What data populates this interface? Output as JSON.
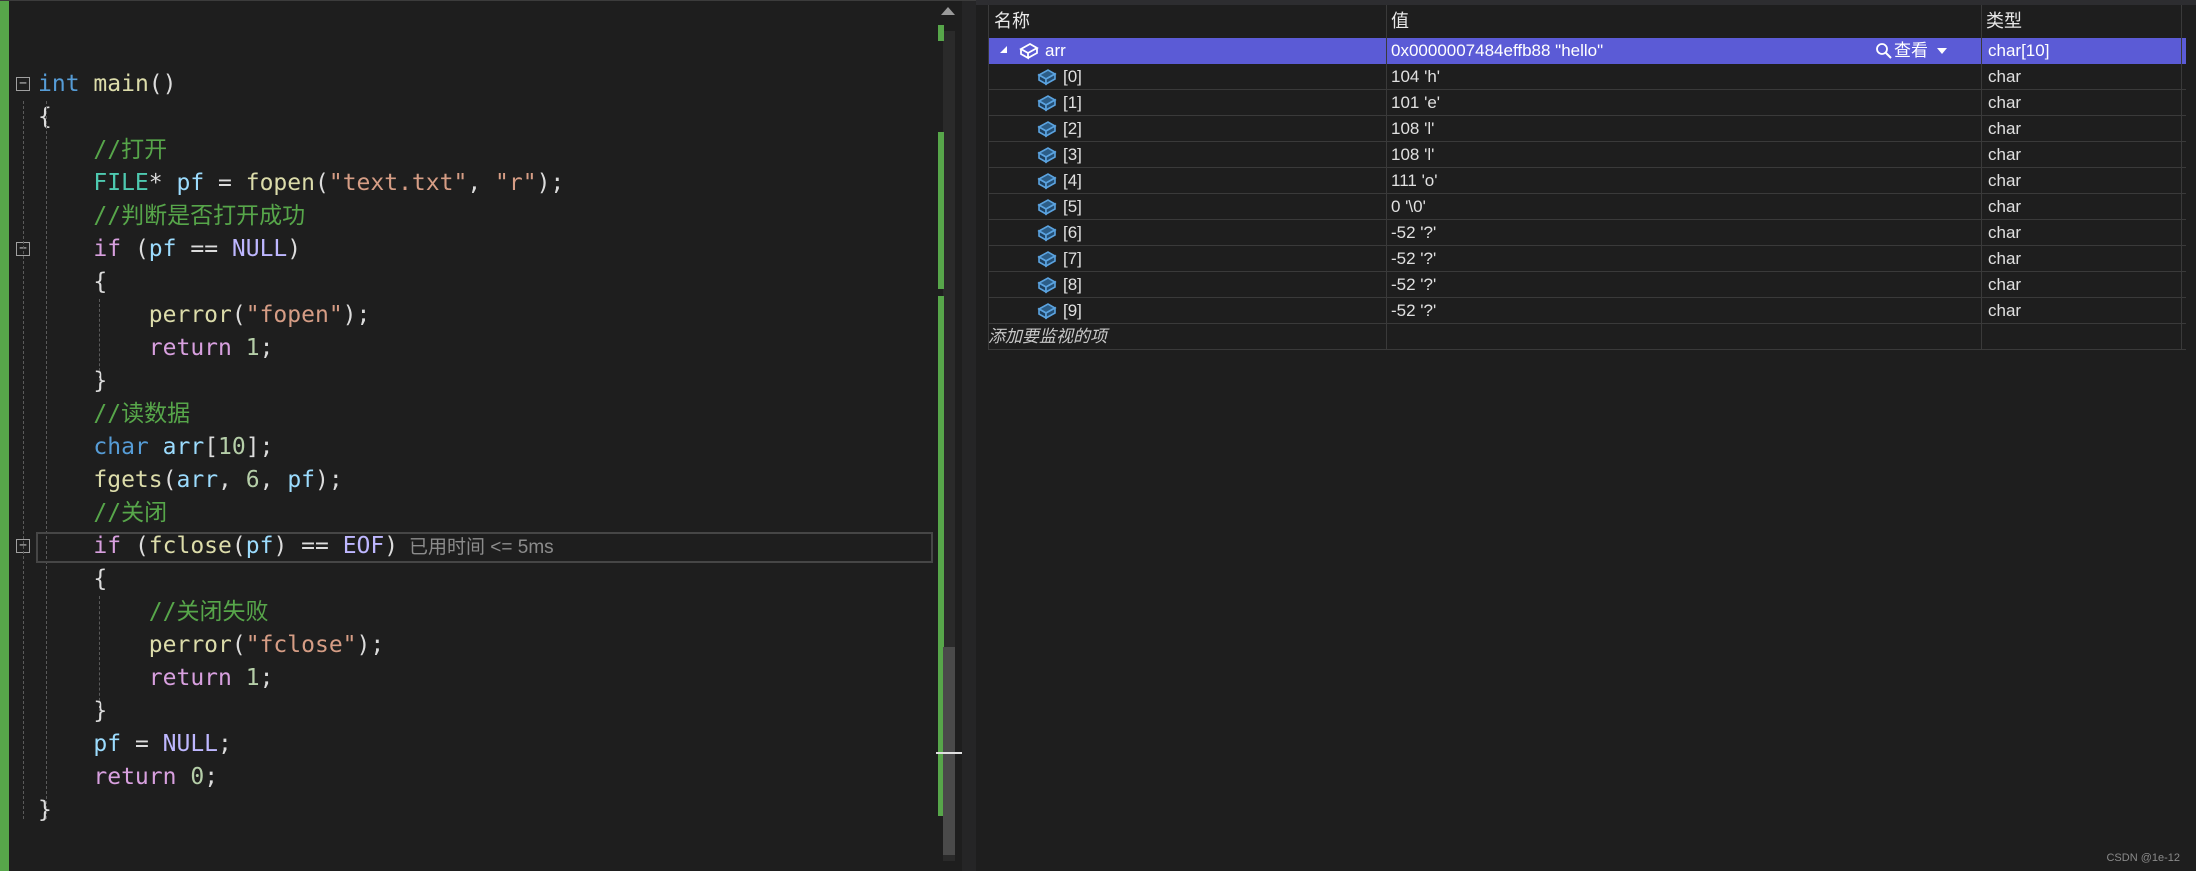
{
  "editor": {
    "lines": [
      [
        {
          "t": "int",
          "c": "kw"
        },
        {
          "t": " ",
          "c": ""
        },
        {
          "t": "main",
          "c": "fn"
        },
        {
          "t": "()",
          "c": ""
        }
      ],
      [
        {
          "t": "{",
          "c": ""
        }
      ],
      [
        {
          "t": "    ",
          "c": ""
        },
        {
          "t": "//打开",
          "c": "cm"
        }
      ],
      [
        {
          "t": "    ",
          "c": ""
        },
        {
          "t": "FILE",
          "c": "ty"
        },
        {
          "t": "* ",
          "c": ""
        },
        {
          "t": "pf",
          "c": "var"
        },
        {
          "t": " = ",
          "c": ""
        },
        {
          "t": "fopen",
          "c": "fn"
        },
        {
          "t": "(",
          "c": ""
        },
        {
          "t": "\"text.txt\"",
          "c": "str"
        },
        {
          "t": ", ",
          "c": ""
        },
        {
          "t": "\"r\"",
          "c": "str"
        },
        {
          "t": ");",
          "c": ""
        }
      ],
      [
        {
          "t": "    ",
          "c": ""
        },
        {
          "t": "//判断是否打开成功",
          "c": "cm"
        }
      ],
      [
        {
          "t": "    ",
          "c": ""
        },
        {
          "t": "if",
          "c": "kw2"
        },
        {
          "t": " (",
          "c": ""
        },
        {
          "t": "pf",
          "c": "var"
        },
        {
          "t": " == ",
          "c": ""
        },
        {
          "t": "NULL",
          "c": "mac"
        },
        {
          "t": ")",
          "c": ""
        }
      ],
      [
        {
          "t": "    {",
          "c": ""
        }
      ],
      [
        {
          "t": "        ",
          "c": ""
        },
        {
          "t": "perror",
          "c": "fn"
        },
        {
          "t": "(",
          "c": ""
        },
        {
          "t": "\"fopen\"",
          "c": "str"
        },
        {
          "t": ");",
          "c": ""
        }
      ],
      [
        {
          "t": "        ",
          "c": ""
        },
        {
          "t": "return",
          "c": "kw2"
        },
        {
          "t": " ",
          "c": ""
        },
        {
          "t": "1",
          "c": "num"
        },
        {
          "t": ";",
          "c": ""
        }
      ],
      [
        {
          "t": "    }",
          "c": ""
        }
      ],
      [
        {
          "t": "    ",
          "c": ""
        },
        {
          "t": "//读数据",
          "c": "cm"
        }
      ],
      [
        {
          "t": "    ",
          "c": ""
        },
        {
          "t": "char",
          "c": "kw"
        },
        {
          "t": " ",
          "c": ""
        },
        {
          "t": "arr",
          "c": "var"
        },
        {
          "t": "[",
          "c": ""
        },
        {
          "t": "10",
          "c": "num"
        },
        {
          "t": "];",
          "c": ""
        }
      ],
      [
        {
          "t": "    ",
          "c": ""
        },
        {
          "t": "fgets",
          "c": "fn"
        },
        {
          "t": "(",
          "c": ""
        },
        {
          "t": "arr",
          "c": "var"
        },
        {
          "t": ", ",
          "c": ""
        },
        {
          "t": "6",
          "c": "num"
        },
        {
          "t": ", ",
          "c": ""
        },
        {
          "t": "pf",
          "c": "var"
        },
        {
          "t": ");",
          "c": ""
        }
      ],
      [
        {
          "t": "    ",
          "c": ""
        },
        {
          "t": "//关闭",
          "c": "cm"
        }
      ],
      [
        {
          "t": "    ",
          "c": ""
        },
        {
          "t": "if",
          "c": "kw2"
        },
        {
          "t": " (",
          "c": ""
        },
        {
          "t": "fclose",
          "c": "fn"
        },
        {
          "t": "(",
          "c": ""
        },
        {
          "t": "pf",
          "c": "var"
        },
        {
          "t": ") == ",
          "c": ""
        },
        {
          "t": "EOF",
          "c": "mac"
        },
        {
          "t": ")",
          "c": ""
        }
      ],
      [
        {
          "t": "    {",
          "c": ""
        }
      ],
      [
        {
          "t": "        ",
          "c": ""
        },
        {
          "t": "//关闭失败",
          "c": "cm"
        }
      ],
      [
        {
          "t": "        ",
          "c": ""
        },
        {
          "t": "perror",
          "c": "fn"
        },
        {
          "t": "(",
          "c": ""
        },
        {
          "t": "\"fclose\"",
          "c": "str"
        },
        {
          "t": ");",
          "c": ""
        }
      ],
      [
        {
          "t": "        ",
          "c": ""
        },
        {
          "t": "return",
          "c": "kw2"
        },
        {
          "t": " ",
          "c": ""
        },
        {
          "t": "1",
          "c": "num"
        },
        {
          "t": ";",
          "c": ""
        }
      ],
      [
        {
          "t": "    }",
          "c": ""
        }
      ],
      [
        {
          "t": "    ",
          "c": ""
        },
        {
          "t": "pf",
          "c": "var"
        },
        {
          "t": " = ",
          "c": ""
        },
        {
          "t": "NULL",
          "c": "mac"
        },
        {
          "t": ";",
          "c": ""
        }
      ],
      [
        {
          "t": "    ",
          "c": ""
        },
        {
          "t": "return",
          "c": "kw2"
        },
        {
          "t": " ",
          "c": ""
        },
        {
          "t": "0",
          "c": "num"
        },
        {
          "t": ";",
          "c": ""
        }
      ],
      [
        {
          "t": "}",
          "c": ""
        }
      ]
    ],
    "perf_tip": "已用时间 <= 5ms",
    "fold_glyph": "−"
  },
  "watch": {
    "headers": {
      "name": "名称",
      "value": "值",
      "type": "类型"
    },
    "root": {
      "name": "arr",
      "value": "0x0000007484effb88 \"hello\"",
      "type": "char[10]",
      "view_label": "查看"
    },
    "items": [
      {
        "name": "[0]",
        "value": "104 'h'",
        "type": "char"
      },
      {
        "name": "[1]",
        "value": "101 'e'",
        "type": "char"
      },
      {
        "name": "[2]",
        "value": "108 'l'",
        "type": "char"
      },
      {
        "name": "[3]",
        "value": "108 'l'",
        "type": "char"
      },
      {
        "name": "[4]",
        "value": "111 'o'",
        "type": "char"
      },
      {
        "name": "[5]",
        "value": "0 '\\0'",
        "type": "char"
      },
      {
        "name": "[6]",
        "value": "-52 '?'",
        "type": "char"
      },
      {
        "name": "[7]",
        "value": "-52 '?'",
        "type": "char"
      },
      {
        "name": "[8]",
        "value": "-52 '?'",
        "type": "char"
      },
      {
        "name": "[9]",
        "value": "-52 '?'",
        "type": "char"
      }
    ],
    "add_placeholder": "添加要监视的项"
  },
  "watermark": "CSDN @1e-12"
}
